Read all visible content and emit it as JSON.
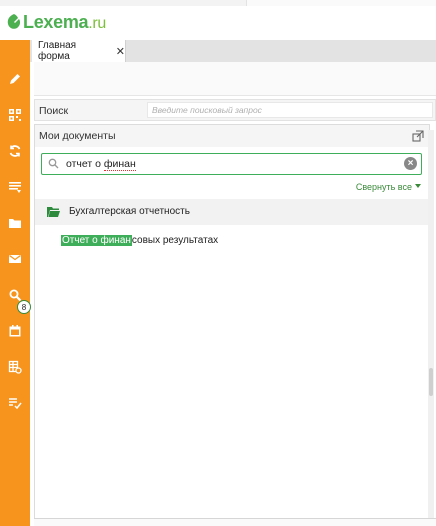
{
  "logo": {
    "brand": "Lexema",
    "tld": ".ru"
  },
  "tabs": [
    {
      "label": "Главная форма",
      "close": "✕"
    }
  ],
  "search": {
    "label": "Поиск",
    "placeholder": "Введите поисковый запрос"
  },
  "documents": {
    "title": "Мои документы",
    "query_prefix": "отчет о ",
    "query_typed": "финан",
    "collapse_label": "Свернуть все",
    "group": {
      "name": "Бухгалтерская отчетность"
    },
    "result": {
      "match": "Отчет о финан",
      "rest": "совых результатах"
    }
  },
  "sidebar": {
    "icons": [
      "pencil-icon",
      "qr-code-icon",
      "sync-icon",
      "list-filter-icon",
      "folder-icon",
      "mail-icon",
      "search-icon",
      "calendar-icon",
      "table-settings-icon",
      "checklist-icon"
    ],
    "mail_badge": "8",
    "color": "#f7941d"
  },
  "colors": {
    "accent": "#3fae5a",
    "sidebar": "#f7941d"
  }
}
